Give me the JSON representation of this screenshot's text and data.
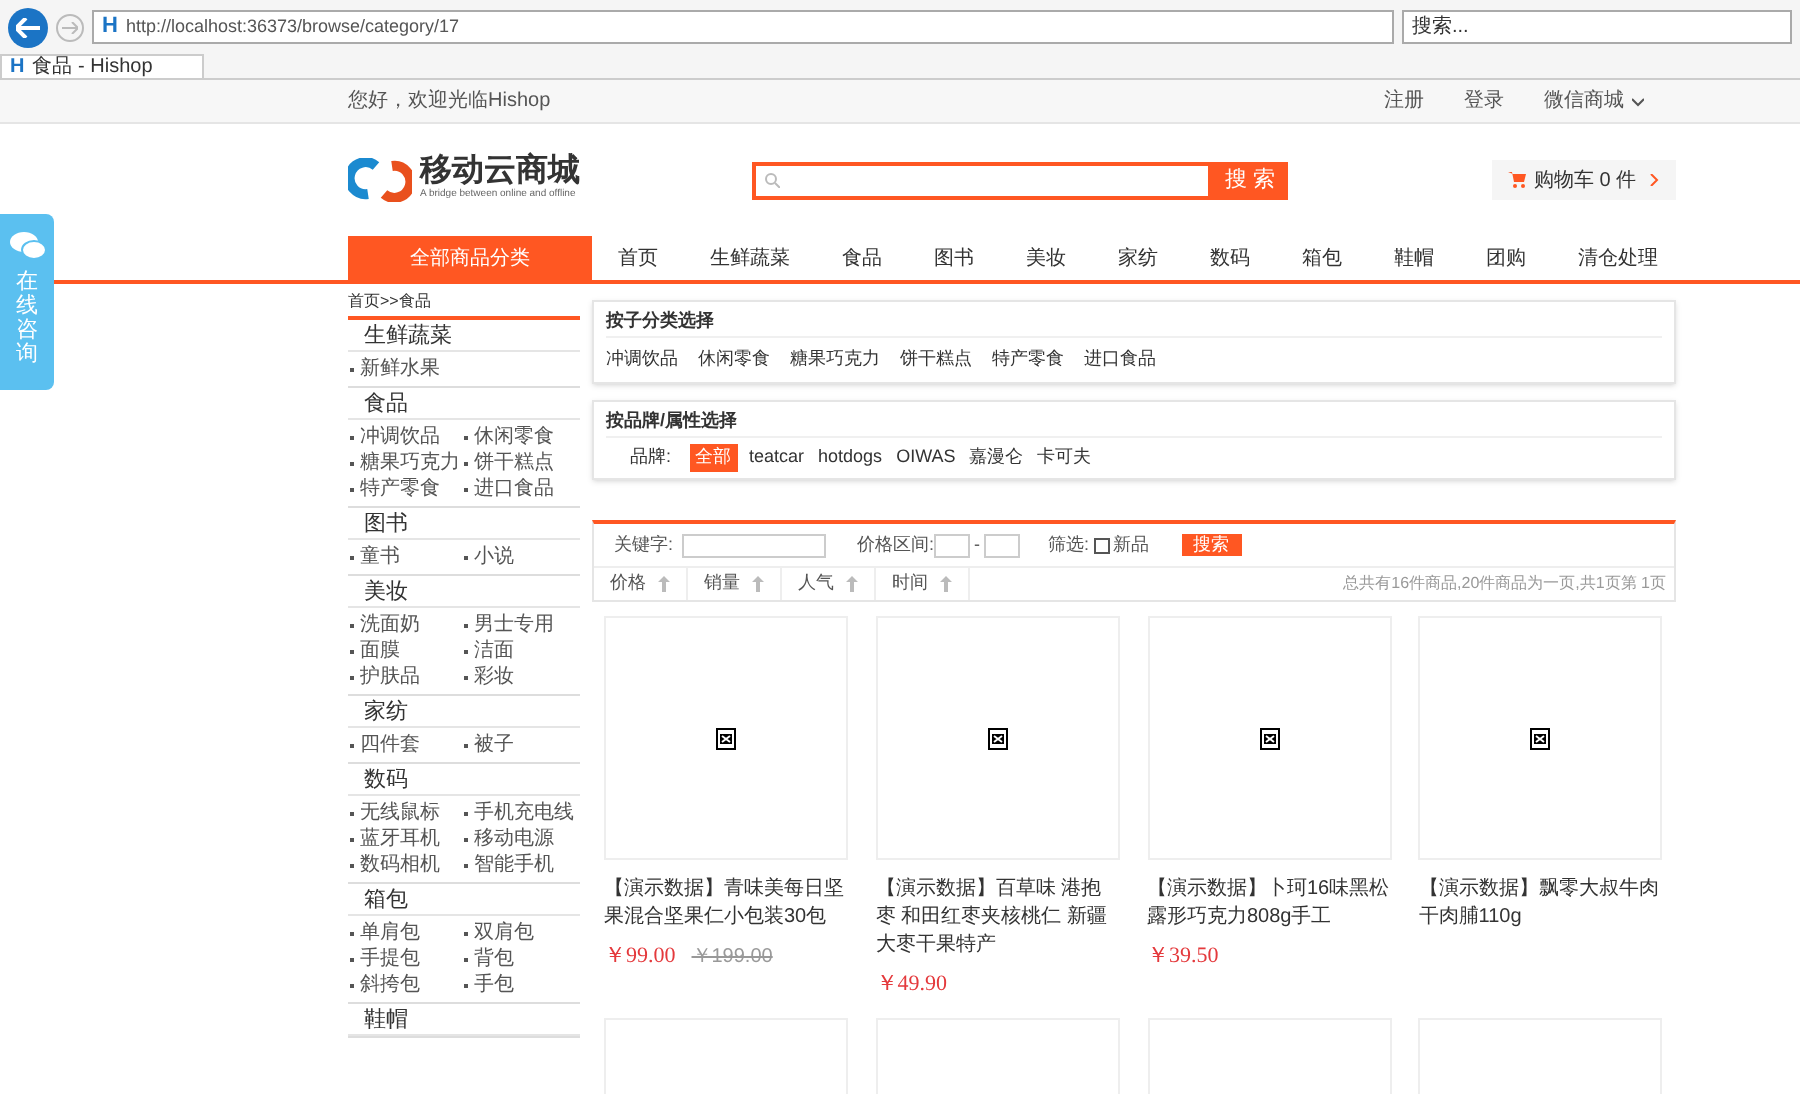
{
  "browser": {
    "site_icon": "H",
    "tab_icon": "H",
    "url": "http://localhost:36373/browse/category/17",
    "search_placeholder": "搜索...",
    "tab_title": "食品 - Hishop"
  },
  "topbar": {
    "greeting": "您好，欢迎光临Hishop",
    "links": [
      "注册",
      "登录",
      "微信商城"
    ]
  },
  "header": {
    "logo_name": "移动云商城",
    "logo_tagline": "A bridge between online and offline",
    "search_button": "搜 索",
    "cart": "购物车 0 件"
  },
  "nav": {
    "all_categories": "全部商品分类",
    "items": [
      {
        "label": "首页"
      },
      {
        "label": "生鲜蔬菜"
      },
      {
        "label": "食品"
      },
      {
        "label": "图书"
      },
      {
        "label": "美妆"
      },
      {
        "label": "家纺"
      },
      {
        "label": "数码"
      },
      {
        "label": "箱包"
      },
      {
        "label": "鞋帽"
      },
      {
        "label": "团购"
      },
      {
        "label": "清仓处理"
      }
    ]
  },
  "consult": "在线咨询",
  "breadcrumb": "首页>>食品",
  "sidebar": [
    {
      "title": "生鲜蔬菜",
      "items": [
        "新鲜水果"
      ]
    },
    {
      "title": "食品",
      "items": [
        "冲调饮品",
        "休闲零食",
        "糖果巧克力",
        "饼干糕点",
        "特产零食",
        "进口食品"
      ]
    },
    {
      "title": "图书",
      "items": [
        "童书",
        "小说"
      ]
    },
    {
      "title": "美妆",
      "items": [
        "洗面奶",
        "男士专用",
        "面膜",
        "洁面",
        "护肤品",
        "彩妆"
      ]
    },
    {
      "title": "家纺",
      "items": [
        "四件套",
        "被子"
      ]
    },
    {
      "title": "数码",
      "items": [
        "无线鼠标",
        "手机充电线",
        "蓝牙耳机",
        "移动电源",
        "数码相机",
        "智能手机"
      ]
    },
    {
      "title": "箱包",
      "items": [
        "单肩包",
        "双肩包",
        "手提包",
        "背包",
        "斜挎包",
        "手包"
      ]
    },
    {
      "title": "鞋帽"
    }
  ],
  "subcategory_filter": {
    "title": "按子分类选择",
    "items": [
      "冲调饮品",
      "休闲零食",
      "糖果巧克力",
      "饼干糕点",
      "特产零食",
      "进口食品"
    ]
  },
  "brand_filter": {
    "title": "按品牌/属性选择",
    "label": "品牌:",
    "brands": [
      {
        "name": "全部",
        "selected": true
      },
      {
        "name": "teatcar",
        "selected": false
      },
      {
        "name": "hotdogs",
        "selected": false
      },
      {
        "name": "OIWAS",
        "selected": false
      },
      {
        "name": "嘉漫仑",
        "selected": false
      },
      {
        "name": "卡可夫",
        "selected": false
      }
    ]
  },
  "search_bar": {
    "keyword_label": "关键字:",
    "price_label": "价格区间:",
    "price_separator": "-",
    "filter_label": "筛选:",
    "new_label": "新品",
    "new_checked": false,
    "button": "搜索"
  },
  "sort": {
    "columns": [
      "价格",
      "销量",
      "人气",
      "时间"
    ],
    "summary": "总共有16件商品,20件商品为一页,共1页第 1页"
  },
  "products": [
    {
      "kind": "full",
      "title": "【演示数据】青味美每日坚果混合坚果仁小包装30包",
      "price": "￥99.00",
      "old_price": "￥199.00"
    },
    {
      "kind": "full",
      "title": "【演示数据】百草味 港抱枣 和田红枣夹核桃仁 新疆大枣干果特产",
      "price": "￥49.90"
    },
    {
      "kind": "full",
      "title": "【演示数据】卜珂16味黑松露形巧克力808g手工",
      "price": "￥39.50"
    },
    {
      "kind": "full",
      "title": "【演示数据】飘零大叔牛肉干肉脯110g"
    },
    {
      "kind": "image_only"
    },
    {
      "kind": "image_only"
    },
    {
      "kind": "image_only"
    },
    {
      "kind": "image_only"
    }
  ]
}
